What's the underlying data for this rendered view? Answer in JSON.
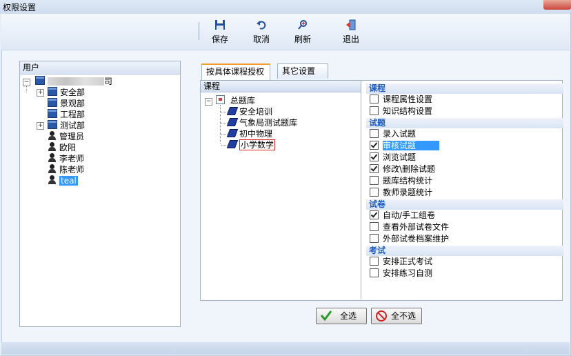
{
  "window": {
    "title": "权限设置"
  },
  "toolbar": {
    "save": "保存",
    "cancel": "取消",
    "refresh": "刷新",
    "exit": "退出"
  },
  "users_panel": {
    "header": "用户",
    "root_label_suffix": "司",
    "items": [
      {
        "label": "安全部",
        "type": "dept",
        "expandable": true
      },
      {
        "label": "景观部",
        "type": "dept",
        "expandable": false
      },
      {
        "label": "工程部",
        "type": "dept",
        "expandable": false
      },
      {
        "label": "测试部",
        "type": "dept",
        "expandable": true
      },
      {
        "label": "管理员",
        "type": "user"
      },
      {
        "label": "欧阳",
        "type": "user"
      },
      {
        "label": "李老师",
        "type": "user"
      },
      {
        "label": "陈老师",
        "type": "user"
      },
      {
        "label": "teal",
        "type": "user",
        "selected": true
      }
    ]
  },
  "tabs": [
    {
      "label": "按具体课程授权",
      "active": true
    },
    {
      "label": "其它设置",
      "active": false
    }
  ],
  "course_panel": {
    "header": "课程",
    "root": "总题库",
    "items": [
      "安全培训",
      "气象局测试题库",
      "初中物理",
      "小学数学"
    ],
    "selected_index": 3
  },
  "permissions": {
    "groups": [
      {
        "name": "课程",
        "items": [
          {
            "label": "课程属性设置",
            "checked": false
          },
          {
            "label": "知识结构设置",
            "checked": false
          }
        ]
      },
      {
        "name": "试题",
        "items": [
          {
            "label": "录入试题",
            "checked": false
          },
          {
            "label": "审核试题",
            "checked": true,
            "highlighted": true
          },
          {
            "label": "浏览试题",
            "checked": true
          },
          {
            "label": "修改\\删除试题",
            "checked": true
          },
          {
            "label": "题库结构统计",
            "checked": false
          },
          {
            "label": "教师录题统计",
            "checked": false
          }
        ]
      },
      {
        "name": "试卷",
        "items": [
          {
            "label": "自动/手工组卷",
            "checked": true
          },
          {
            "label": "查看外部试卷文件",
            "checked": false
          },
          {
            "label": "外部试卷档案维护",
            "checked": false
          }
        ]
      },
      {
        "name": "考试",
        "items": [
          {
            "label": "安排正式考试",
            "checked": false
          },
          {
            "label": "安排练习自测",
            "checked": false
          }
        ]
      }
    ]
  },
  "buttons": {
    "select_all": "全选",
    "select_none": "全不选"
  },
  "colors": {
    "accent": "#3399ff",
    "group_text": "#1f5cc4",
    "tab_accent": "#f0a030"
  }
}
